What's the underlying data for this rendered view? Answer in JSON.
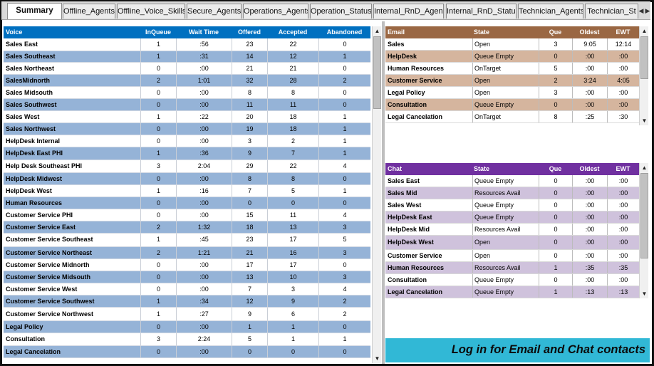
{
  "tabs": [
    "Summary",
    "Offline_Agents",
    "Offline_Voice_Skills",
    "Secure_Agents",
    "Operations_Agents",
    "Operation_Status",
    "Internal_RnD_Agents",
    "Internal_RnD_Status",
    "Technician_Agents",
    "Technician_St"
  ],
  "active_tab": "Summary",
  "tab_nav": {
    "prev": "◀",
    "next": "▶"
  },
  "voice": {
    "headers": [
      "Voice",
      "InQueue",
      "Wait Time",
      "Offered",
      "Accepted",
      "Abandoned"
    ],
    "rows": [
      [
        "Sales East",
        "1",
        ":56",
        "23",
        "22",
        "0"
      ],
      [
        "Sales Southeast",
        "1",
        ":31",
        "14",
        "12",
        "1"
      ],
      [
        "Sales Northeast",
        "0",
        ":00",
        "21",
        "21",
        "0"
      ],
      [
        "SalesMidnorth",
        "2",
        "1:01",
        "32",
        "28",
        "2"
      ],
      [
        "Sales Midsouth",
        "0",
        ":00",
        "8",
        "8",
        "0"
      ],
      [
        "Sales Southwest",
        "0",
        ":00",
        "11",
        "11",
        "0"
      ],
      [
        "Sales West",
        "1",
        ":22",
        "20",
        "18",
        "1"
      ],
      [
        "Sales Northwest",
        "0",
        ":00",
        "19",
        "18",
        "1"
      ],
      [
        "HelpDesk Internal",
        "0",
        ":00",
        "3",
        "2",
        "1"
      ],
      [
        "HelpDesk East PHI",
        "1",
        ":36",
        "9",
        "7",
        "1"
      ],
      [
        "Help Desk Southeast PHI",
        "3",
        "2:04",
        "29",
        "22",
        "4"
      ],
      [
        "HelpDesk Midwest",
        "0",
        ":00",
        "8",
        "8",
        "0"
      ],
      [
        "HelpDesk West",
        "1",
        ":16",
        "7",
        "5",
        "1"
      ],
      [
        "Human Resources",
        "0",
        ":00",
        "0",
        "0",
        "0"
      ],
      [
        "Customer Service PHI",
        "0",
        ":00",
        "15",
        "11",
        "4"
      ],
      [
        "Customer Service East",
        "2",
        "1:32",
        "18",
        "13",
        "3"
      ],
      [
        "Customer Service Southeast",
        "1",
        ":45",
        "23",
        "17",
        "5"
      ],
      [
        "Customer Service Northeast",
        "2",
        "1:21",
        "21",
        "16",
        "3"
      ],
      [
        "Customer Service Midnorth",
        "0",
        ":00",
        "17",
        "17",
        "0"
      ],
      [
        "Customer Service Midsouth",
        "0",
        ":00",
        "13",
        "10",
        "3"
      ],
      [
        "Customer Service West",
        "0",
        ":00",
        "7",
        "3",
        "4"
      ],
      [
        "Customer Service Southwest",
        "1",
        ":34",
        "12",
        "9",
        "2"
      ],
      [
        "Customer Service Northwest",
        "1",
        ":27",
        "9",
        "6",
        "2"
      ],
      [
        "Legal Policy",
        "0",
        ":00",
        "1",
        "1",
        "0"
      ],
      [
        "Consultation",
        "3",
        "2:24",
        "5",
        "1",
        "1"
      ],
      [
        "Legal Cancelation",
        "0",
        ":00",
        "0",
        "0",
        "0"
      ]
    ]
  },
  "email": {
    "headers": [
      "Email",
      "State",
      "Que",
      "Oldest",
      "EWT"
    ],
    "rows": [
      [
        "Sales",
        "Open",
        "3",
        "9:05",
        "12:14"
      ],
      [
        "HelpDesk",
        "Queue Empty",
        "0",
        ":00",
        ":00"
      ],
      [
        "Human Resources",
        "OnTarget",
        "5",
        ":00",
        ":00"
      ],
      [
        "Customer Service",
        "Open",
        "2",
        "3:24",
        "4:05"
      ],
      [
        "Legal Policy",
        "Open",
        "3",
        ":00",
        ":00"
      ],
      [
        "Consultation",
        "Queue Empty",
        "0",
        ":00",
        ":00"
      ],
      [
        "Legal Cancelation",
        "OnTarget",
        "8",
        ":25",
        ":30"
      ]
    ]
  },
  "chat": {
    "headers": [
      "Chat",
      "State",
      "Que",
      "Oldest",
      "EWT"
    ],
    "rows": [
      [
        "Sales East",
        "Queue Empty",
        "0",
        ":00",
        ":00"
      ],
      [
        "Sales Mid",
        "Resources Avail",
        "0",
        ":00",
        ":00"
      ],
      [
        "Sales West",
        "Queue Empty",
        "0",
        ":00",
        ":00"
      ],
      [
        "HelpDesk East",
        "Queue Empty",
        "0",
        ":00",
        ":00"
      ],
      [
        "HelpDesk Mid",
        "Resources Avail",
        "0",
        ":00",
        ":00"
      ],
      [
        "HelpDesk West",
        "Open",
        "0",
        ":00",
        ":00"
      ],
      [
        "Customer Service",
        "Open",
        "0",
        ":00",
        ":00"
      ],
      [
        "Human Resources",
        "Resources Avail",
        "1",
        ":35",
        ":35"
      ],
      [
        "Consultation",
        "Queue Empty",
        "0",
        ":00",
        ":00"
      ],
      [
        "Legal Cancelation",
        "Queue Empty",
        "1",
        ":13",
        ":13"
      ]
    ]
  },
  "banner_text": "Log in for Email and Chat contacts",
  "scroll_arrows": {
    "up": "▲",
    "down": "▼"
  },
  "colors": {
    "voice_header": "#0070c0",
    "voice_alt_row": "#95b3d7",
    "email_header": "#9a6743",
    "email_alt_row": "#d5b59e",
    "chat_header": "#7030a0",
    "chat_alt_row": "#cfc2dc",
    "banner": "#31b8d6"
  }
}
